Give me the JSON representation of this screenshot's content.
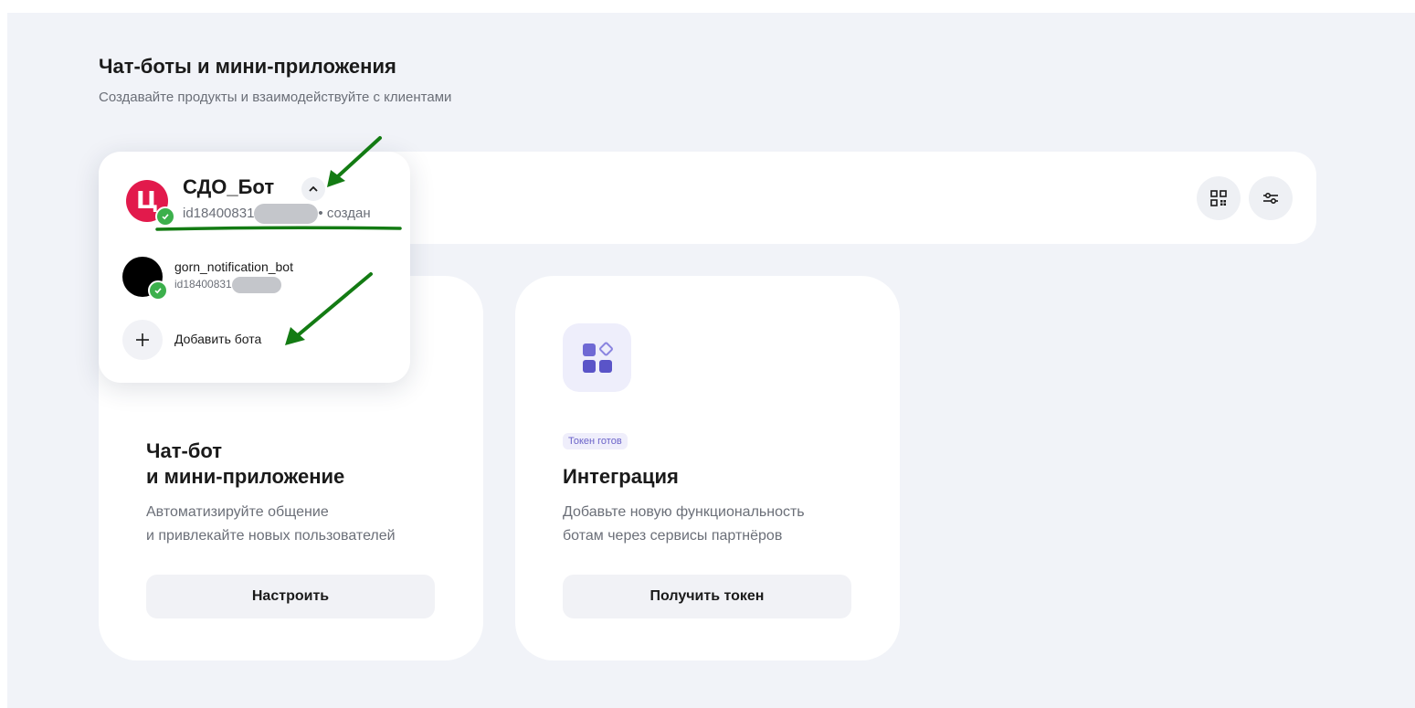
{
  "header": {
    "title": "Чат-боты и мини-приложения",
    "subtitle": "Создавайте продукты и взаимодействуйте с клиентами"
  },
  "toolbar": {
    "qr_icon": "qr-code-icon",
    "settings_icon": "sliders-icon"
  },
  "selected_bot": {
    "name": "СДО_Бот",
    "id_prefix": "id18400831",
    "status_suffix": "• создан",
    "avatar_letter": "Ц",
    "avatar_color": "#e21a4c"
  },
  "bot_list": [
    {
      "name": "gorn_notification_bot",
      "id_prefix": "id18400831"
    }
  ],
  "add_bot_label": "Добавить бота",
  "cards": [
    {
      "title_line1": "Чат-бот",
      "title_line2": "и мини-приложение",
      "desc_line1": "Автоматизируйте общение",
      "desc_line2": "и привлекайте новых пользователей",
      "button": "Настроить"
    },
    {
      "badge": "Токен готов",
      "title": "Интеграция",
      "desc_line1": "Добавьте новую функциональность",
      "desc_line2": "ботам через сервисы партнёров",
      "button": "Получить токен"
    }
  ],
  "colors": {
    "accent_purple": "#6b63c9",
    "check_green": "#3cb04c",
    "annotation_green": "#137b13"
  }
}
